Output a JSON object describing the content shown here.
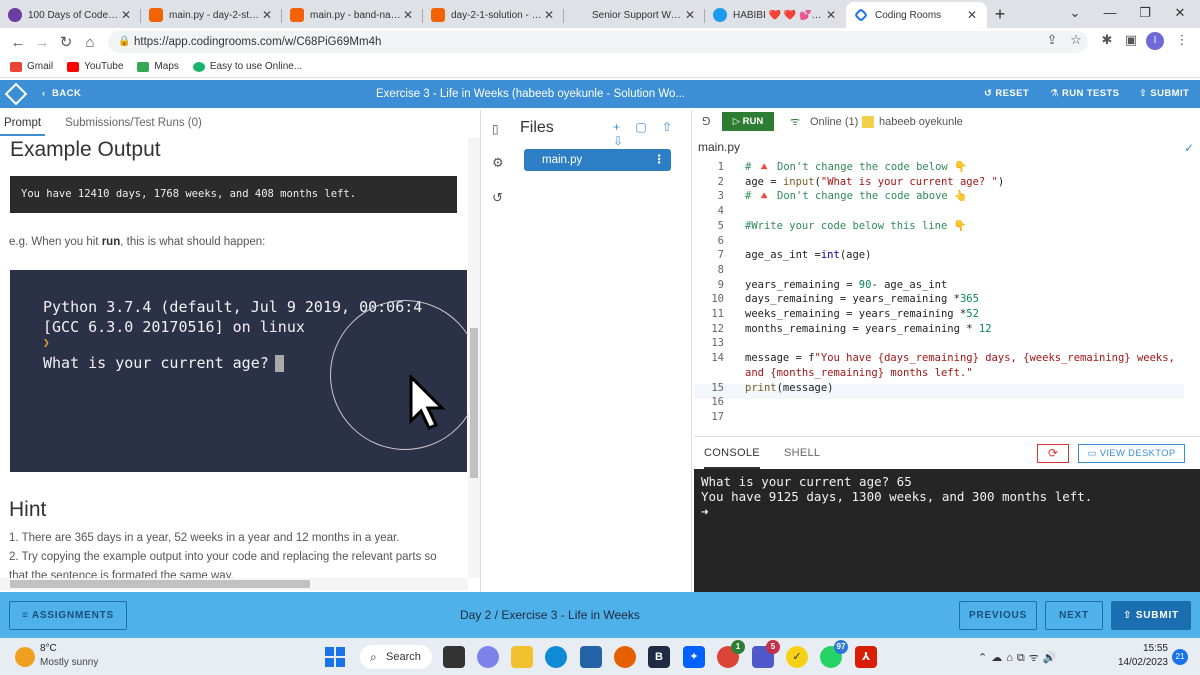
{
  "browser": {
    "tabs": [
      {
        "title": "100 Days of Code: Th",
        "color": "#6b3fa0"
      },
      {
        "title": "main.py - day-2-start",
        "color": "#f26207"
      },
      {
        "title": "main.py - band-name",
        "color": "#f26207"
      },
      {
        "title": "day-2-1-solution - Re",
        "color": "#f26207"
      },
      {
        "title": "Senior Support Work",
        "color": "#ffffff"
      },
      {
        "title": "HABIBI ❤️ ❤️ 💕 on",
        "color": "#1d9bf0"
      },
      {
        "title": "Coding Rooms",
        "color": "#1a73e8"
      }
    ],
    "url": "https://app.codingrooms.com/w/C68PiG69Mm4h",
    "bookmarks": [
      "Gmail",
      "YouTube",
      "Maps",
      "Easy to use Online..."
    ],
    "profile_initial": "I"
  },
  "header": {
    "back_label": "BACK",
    "title": "Exercise 3 - Life in Weeks (habeeb oyekunle - Solution Wo...",
    "reset_label": "RESET",
    "run_tests_label": "RUN TESTS",
    "submit_label": "SUBMIT"
  },
  "prompt": {
    "tab_prompt": "Prompt",
    "tab_submissions": "Submissions/Test Runs (0)",
    "example_heading": "Example Output",
    "example_output": "You have 12410 days, 1768 weeks, and 408 months left.",
    "eg_before": "e.g. When you hit ",
    "eg_bold": "run",
    "eg_after": ", this is what should happen:",
    "term_line1": "Python 3.7.4 (default, Jul  9 2019, 00:06:4",
    "term_line2": "[GCC 6.3.0 20170516] on linux",
    "term_prompt_mark": "❯",
    "term_line3": "What is your current age?",
    "hint_heading": "Hint",
    "hint1": "1. There are 365 days in a year, 52 weeks in a year and 12 months in a year.",
    "hint2": "2. Try copying the example output into your code and replacing the relevant parts so",
    "hint3": "that the sentence is formated the same way."
  },
  "files": {
    "label": "Files",
    "file_name": "main.py"
  },
  "editor": {
    "run_label": "RUN",
    "online": "Online (1)",
    "user": "habeeb oyekunle",
    "tab": "main.py",
    "lines": [
      {
        "n": "1",
        "html": "<span class=\"cm\"># 🔺 Don't change the code below 👇</span>"
      },
      {
        "n": "2",
        "html": "age = <span class=\"fn\">input</span>(<span class=\"str\">\"What is your current age? \"</span>)"
      },
      {
        "n": "3",
        "html": "<span class=\"cm\"># 🔺 Don't change the code above 👆</span>"
      },
      {
        "n": "4",
        "html": ""
      },
      {
        "n": "5",
        "html": "<span class=\"cm\">#Write your code below this line 👇</span>"
      },
      {
        "n": "6",
        "html": ""
      },
      {
        "n": "7",
        "html": "age_as_int =<span class=\"kw\">int</span>(age)"
      },
      {
        "n": "8",
        "html": ""
      },
      {
        "n": "9",
        "html": "years_remaining = <span class=\"num\">90</span>- age_as_int"
      },
      {
        "n": "10",
        "html": "days_remaining = years_remaining *<span class=\"num\">365</span>"
      },
      {
        "n": "11",
        "html": "weeks_remaining = years_remaining *<span class=\"num\">52</span>"
      },
      {
        "n": "12",
        "html": "months_remaining = years_remaining * <span class=\"num\">12</span>"
      },
      {
        "n": "13",
        "html": ""
      },
      {
        "n": "14",
        "html": "message = f<span class=\"str\">\"You have {days_remaining} days, {weeks_remaining} weeks,</span>"
      },
      {
        "n": "",
        "html": "<span class=\"str\">and {months_remaining} months left.\"</span>"
      },
      {
        "n": "15",
        "html": "<span class=\"fn\">print</span>(message)"
      },
      {
        "n": "16",
        "html": ""
      },
      {
        "n": "17",
        "html": ""
      }
    ]
  },
  "console": {
    "tab_console": "CONSOLE",
    "tab_shell": "SHELL",
    "view_desktop": "VIEW DESKTOP",
    "line1": "What is your current age? 65",
    "line2": "You have 9125 days, 1300 weeks, and 300 months left.",
    "prompt": "➜"
  },
  "footer": {
    "assignments": "ASSIGNMENTS",
    "crumb": "Day 2 / Exercise 3 - Life in Weeks",
    "previous": "PREVIOUS",
    "next": "NEXT",
    "submit": "SUBMIT"
  },
  "taskbar": {
    "temp": "8°C",
    "weather": "Mostly sunny",
    "search": "Search",
    "time": "15:55",
    "date": "14/02/2023",
    "notif": "21",
    "badge_teams": "5",
    "badge_whatsapp": "97"
  }
}
